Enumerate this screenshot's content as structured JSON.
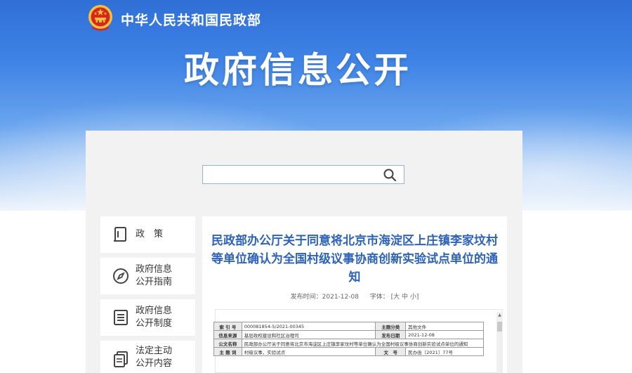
{
  "header": {
    "ministry_name": "中华人民共和国民政部",
    "page_title": "政府信息公开"
  },
  "search": {
    "placeholder": "",
    "value": ""
  },
  "nav": {
    "items": [
      {
        "label_line1": "政　策",
        "label_line2": ""
      },
      {
        "label_line1": "政府信息",
        "label_line2": "公开指南"
      },
      {
        "label_line1": "政府信息",
        "label_line2": "公开制度"
      },
      {
        "label_line1": "法定主动",
        "label_line2": "公开内容"
      }
    ]
  },
  "article": {
    "title": "民政部办公厅关于同意将北京市海淀区上庄镇李家坟村等单位确认为全国村级议事协商创新实验试点单位的通知",
    "publish_label": "发布时间：2021-12-08",
    "font_label": "字体：",
    "font_sizes": "[大 中 小]"
  },
  "info_table": {
    "index_key": "索 引 号",
    "index_val": "000081854-5/2021-00345",
    "category_key": "主题分类",
    "category_val": "其他文件",
    "source_key": "信息来源",
    "source_val": "基层政权建设和社区治理司",
    "date_key": "发布日期",
    "date_val": "2021-12-08",
    "title_key": "公文名称",
    "title_val": "民政部办公厅关于同意将北京市海淀区上庄镇李家坟村等单位确认为全国村级议事协商创新实验试点单位的通知",
    "subject_key": "主 题 词",
    "subject_val": "村级议事，实验试点",
    "docno_key": "文　号",
    "docno_val": "民办函〔2021〕77号"
  },
  "colors": {
    "title_blue": "#2d62b7",
    "hero_blue": "#2f6fd6",
    "emblem_red": "#d7261e",
    "emblem_gold": "#f3c23a"
  }
}
